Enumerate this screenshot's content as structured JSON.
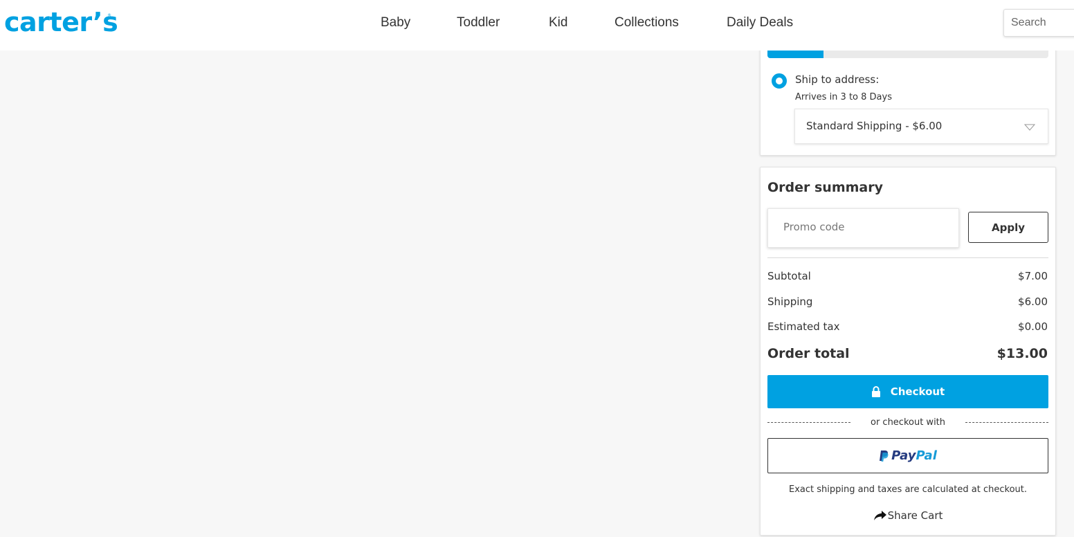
{
  "header": {
    "logo": "carter’s",
    "logo_mark": "®",
    "nav": [
      "Baby",
      "Toddler",
      "Kid",
      "Collections",
      "Daily Deals"
    ],
    "search_placeholder": "Search"
  },
  "shipping": {
    "progress_fraction": 0.2,
    "option_label": "Ship to address:",
    "arrival": "Arrives in 3 to 8 Days",
    "selected_method": "Standard Shipping - $6.00"
  },
  "summary": {
    "title": "Order summary",
    "promo_placeholder": "Promo code",
    "apply_label": "Apply",
    "rows": [
      {
        "label": "Subtotal",
        "value": "$7.00"
      },
      {
        "label": "Shipping",
        "value": "$6.00"
      },
      {
        "label": "Estimated tax",
        "value": "$0.00"
      }
    ],
    "total_label": "Order total",
    "total_value": "$13.00",
    "checkout_label": "Checkout",
    "or_text": "or checkout with",
    "paypal_pay": "Pay",
    "paypal_pal": "Pal",
    "note": "Exact shipping and taxes are calculated at checkout.",
    "share_label": "Share Cart"
  },
  "colors": {
    "brand": "#00a1e1",
    "paypal_dark": "#253b80",
    "paypal_light": "#179bd7"
  },
  "icons": [
    "lock-icon",
    "paypal-icon",
    "share-icon",
    "chevron-down-icon"
  ]
}
